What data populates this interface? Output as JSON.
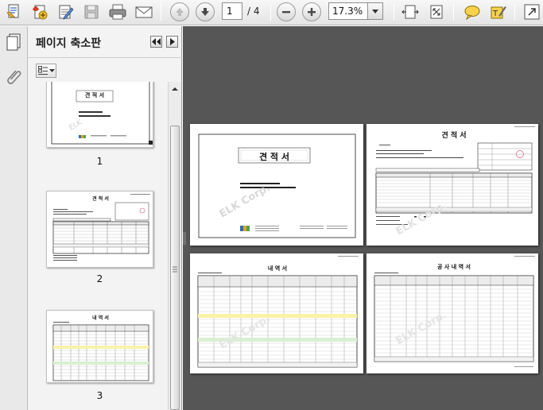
{
  "toolbar": {
    "current_page": "1",
    "total_pages": "/ 4",
    "zoom": "17.3%",
    "icons": [
      "edit-document-icon",
      "pdf-create-icon",
      "pencil-edit-icon",
      "save-icon",
      "print-icon",
      "email-icon",
      "prev-page-icon",
      "next-page-icon",
      "zoom-out-icon",
      "zoom-in-icon",
      "fit-width-icon",
      "fit-page-icon",
      "comment-icon",
      "highlight-icon",
      "expand-icon"
    ]
  },
  "panel": {
    "title": "페이지 축소판"
  },
  "thumbnails": [
    {
      "label": "1"
    },
    {
      "label": "2"
    },
    {
      "label": "3"
    }
  ],
  "pages": {
    "p1_title": "견 적 서",
    "p2_title": "견 적 서",
    "p3_title": "내 역 서",
    "p4_title": "공 사 내 역 서",
    "watermark": "ELK Corp."
  },
  "colors": {
    "doc_background": "#565656",
    "panel_background": "#f3f3f3",
    "accent_blue": "#2f6fb5"
  }
}
